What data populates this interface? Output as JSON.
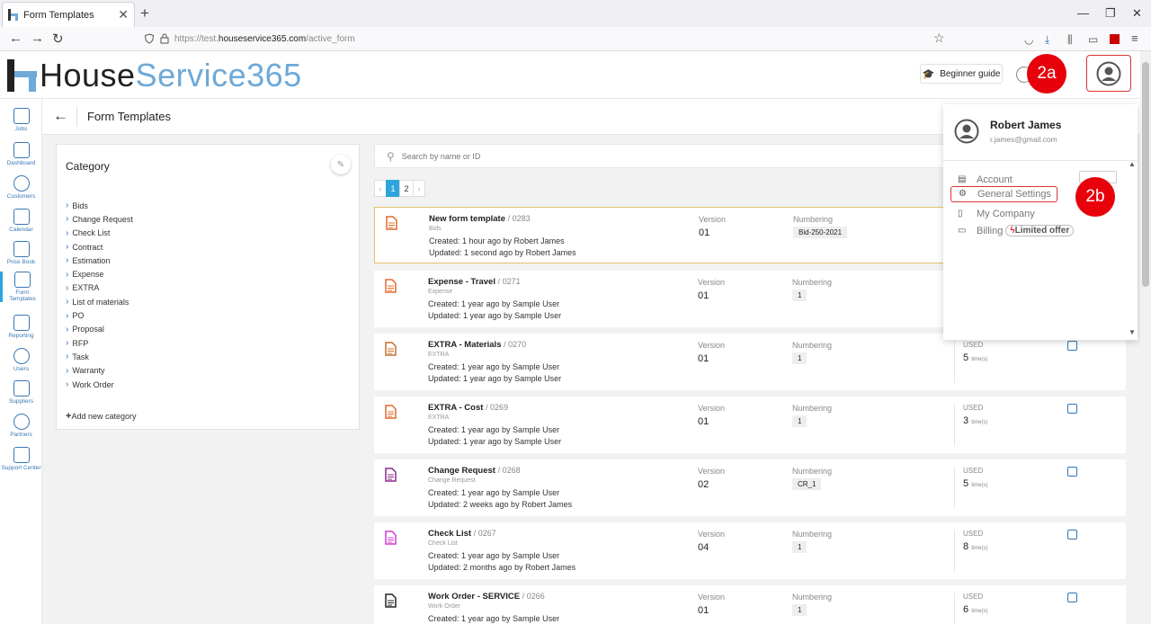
{
  "browser": {
    "tab_title": "Form Templates",
    "url_prefix": "https://test.",
    "url_domain": "houseservice365.com",
    "url_path": "/active_form"
  },
  "header": {
    "logo_part1": "House",
    "logo_part2": "Service365",
    "guide_label": "Beginner guide",
    "badge_2a": "2a",
    "badge_2b": "2b"
  },
  "sidebar": {
    "items": [
      {
        "label": "Jobs",
        "icon": "tools-icon"
      },
      {
        "label": "Dashboard",
        "icon": "bar-chart-icon"
      },
      {
        "label": "Customers",
        "icon": "target-icon"
      },
      {
        "label": "Calendar",
        "icon": "calendar-icon"
      },
      {
        "label": "Price Book",
        "icon": "price-tag-icon"
      },
      {
        "label": "Form Templates",
        "icon": "form-icon"
      },
      {
        "label": "Reporting",
        "icon": "report-icon"
      },
      {
        "label": "Users",
        "icon": "users-icon"
      },
      {
        "label": "Suppliers",
        "icon": "truck-icon"
      },
      {
        "label": "Partners",
        "icon": "network-icon"
      },
      {
        "label": "Support Center",
        "icon": "help-icon"
      }
    ]
  },
  "page": {
    "title": "Form Templates"
  },
  "category": {
    "title": "Category",
    "items": [
      "Bids",
      "Change Request",
      "Check List",
      "Contract",
      "Estimation",
      "Expense",
      "EXTRA",
      "List of materials",
      "PO",
      "Proposal",
      "RFP",
      "Task",
      "Warranty",
      "Work Order"
    ],
    "add_label": "Add new category"
  },
  "search": {
    "placeholder": "Search by name or ID"
  },
  "pagination": {
    "pages": [
      "1",
      "2"
    ],
    "current": "1",
    "prev": "‹",
    "next": "›"
  },
  "labels": {
    "version": "Version",
    "numbering": "Numbering",
    "used": "USED",
    "times": "time(s)"
  },
  "templates": [
    {
      "name": "New form template",
      "id": "/ 0283",
      "category": "Bids",
      "created": "Created: 1 hour ago by Robert James",
      "updated": "Updated: 1 second ago by Robert James",
      "version": "01",
      "numbering": "Bid-250-2021",
      "used": "",
      "icon_color": "#e06a2e"
    },
    {
      "name": "Expense - Travel",
      "id": "/ 0271",
      "category": "Expense",
      "created": "Created: 1 year ago by Sample User",
      "updated": "Updated: 1 year ago by Sample User",
      "version": "01",
      "numbering": "1",
      "used": "",
      "icon_color": "#e06a2e"
    },
    {
      "name": "EXTRA - Materials",
      "id": "/ 0270",
      "category": "EXTRA",
      "created": "Created: 1 year ago by Sample User",
      "updated": "Updated: 1 year ago by Sample User",
      "version": "01",
      "numbering": "1",
      "used": "5",
      "icon_color": "#c0702e"
    },
    {
      "name": "EXTRA - Cost",
      "id": "/ 0269",
      "category": "EXTRA",
      "created": "Created: 1 year ago by Sample User",
      "updated": "Updated: 1 year ago by Sample User",
      "version": "01",
      "numbering": "1",
      "used": "3",
      "icon_color": "#e06a2e"
    },
    {
      "name": "Change Request",
      "id": "/ 0268",
      "category": "Change Request",
      "created": "Created: 1 year ago by Sample User",
      "updated": "Updated: 2 weeks ago by Robert James",
      "version": "02",
      "numbering": "CR_1",
      "used": "5",
      "icon_color": "#8a2a8a"
    },
    {
      "name": "Check List",
      "id": "/ 0267",
      "category": "Check List",
      "created": "Created: 1 year ago by Sample User",
      "updated": "Updated: 2 months ago by Robert James",
      "version": "04",
      "numbering": "1",
      "used": "8",
      "icon_color": "#d23bd2"
    },
    {
      "name": "Work Order - SERVICE",
      "id": "/ 0266",
      "category": "Work Order",
      "created": "Created: 1 year ago by Sample User",
      "updated": "",
      "version": "01",
      "numbering": "1",
      "used": "6",
      "icon_color": "#222222"
    }
  ],
  "user_menu": {
    "name": "Robert James",
    "email": "r.james@gmail.com",
    "items": {
      "account": "Account",
      "general_settings": "General Settings",
      "my_company": "My Company",
      "billing": "Billing",
      "offer": "Limited offer"
    }
  },
  "colors": {
    "accent": "#2ea4dc",
    "badge_red": "#e8000b",
    "logo_blue": "#6ea9d8"
  }
}
